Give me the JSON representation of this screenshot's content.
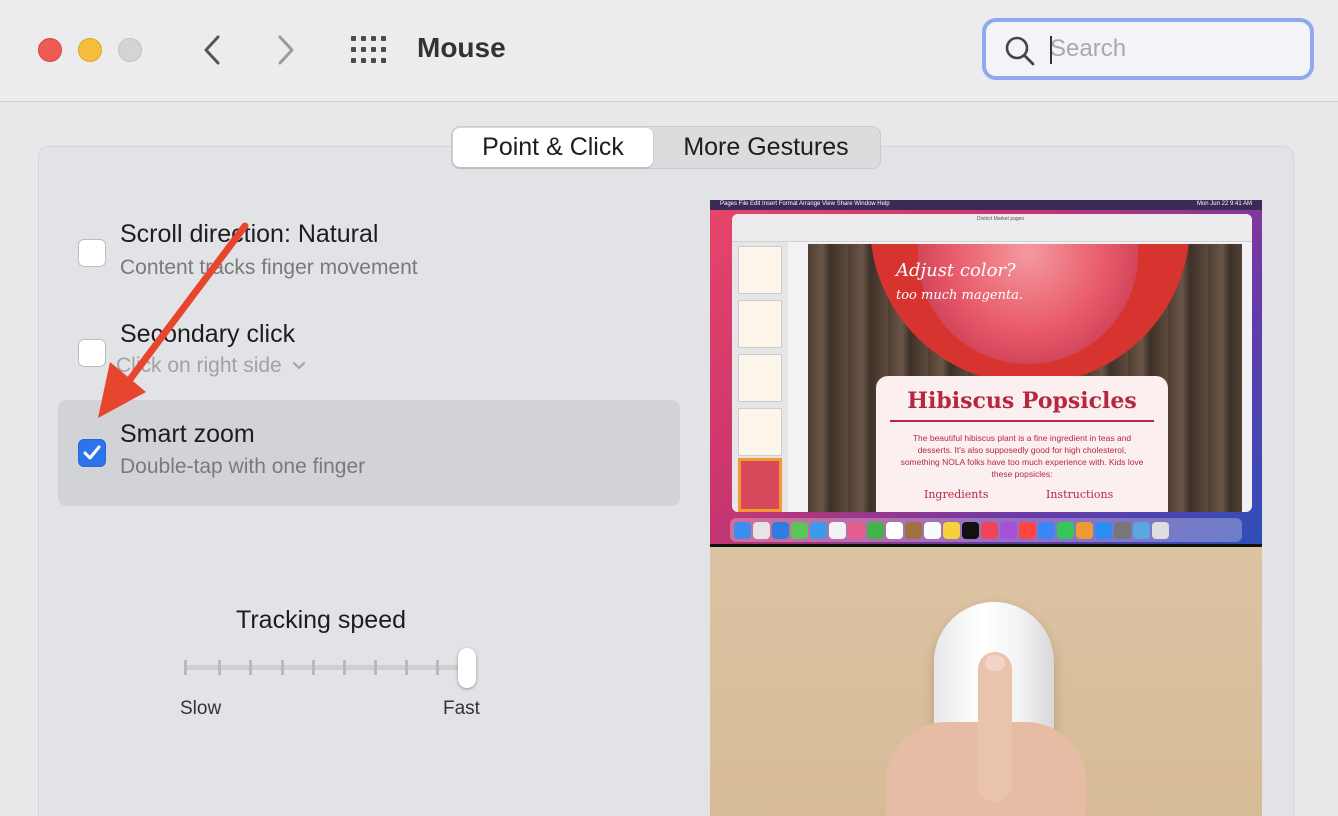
{
  "window": {
    "title": "Mouse",
    "search_placeholder": "Search"
  },
  "tabs": [
    {
      "label": "Point & Click",
      "active": true
    },
    {
      "label": "More Gestures",
      "active": false
    }
  ],
  "options": [
    {
      "title": "Scroll direction: Natural",
      "subtitle": "Content tracks finger movement",
      "checked": false
    },
    {
      "title": "Secondary click",
      "subtitle": "Click on right side",
      "checked": false
    },
    {
      "title": "Smart zoom",
      "subtitle": "Double-tap with one finger",
      "checked": true
    }
  ],
  "tracking": {
    "label": "Tracking speed",
    "min_label": "Slow",
    "max_label": "Fast",
    "value_fraction": 1.0
  },
  "preview": {
    "menubar_left": "Pages  File  Edit  Insert  Format  Arrange  View  Share  Window  Help",
    "menubar_right": "Mon Jun 22  9:41 AM",
    "doc_title": "District Market pages",
    "handwriting_1": "Adjust color?",
    "handwriting_2": "too much magenta.",
    "card_title": "Hibiscus Popsicles",
    "card_body": "The beautiful hibiscus plant is a fine ingredient in teas and desserts. It's also supposedly good for high cholesterol, something NOLA folks have too much experience with. Kids love these popsicles:",
    "col_left": "Ingredients",
    "col_right": "Instructions"
  },
  "colors": {
    "accent": "#2d73ea",
    "annotation_arrow": "#e8452f",
    "search_ring": "#8fa8ee"
  }
}
